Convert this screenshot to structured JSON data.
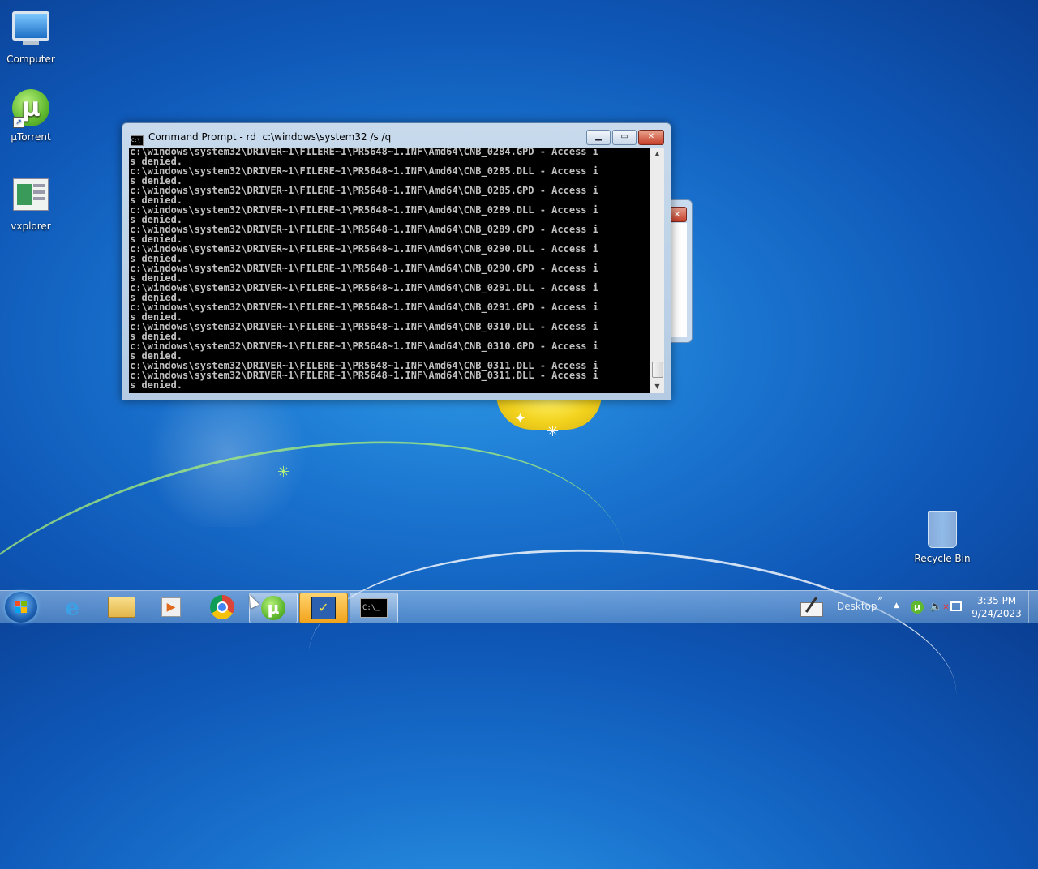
{
  "desktop": {
    "icons": [
      {
        "label": "Computer",
        "icon": "computer-icon"
      },
      {
        "label": "µTorrent",
        "icon": "utorrent-icon"
      },
      {
        "label": "vxplorer",
        "icon": "vxplorer-icon"
      },
      {
        "label": "Recycle Bin",
        "icon": "recycle-bin-icon"
      }
    ]
  },
  "cmd_window": {
    "title": "Command Prompt - rd  c:\\windows\\system32 /s /q",
    "buttons": {
      "minimize": "minimize-icon",
      "maximize": "maximize-icon",
      "close": "close-icon"
    },
    "lines": [
      "c:\\windows\\system32\\DRIVER~1\\FILERE~1\\PR5648~1.INF\\Amd64\\CNB_0284.GPD - Access i",
      "s denied.",
      "c:\\windows\\system32\\DRIVER~1\\FILERE~1\\PR5648~1.INF\\Amd64\\CNB_0285.DLL - Access i",
      "s denied.",
      "c:\\windows\\system32\\DRIVER~1\\FILERE~1\\PR5648~1.INF\\Amd64\\CNB_0285.GPD - Access i",
      "s denied.",
      "c:\\windows\\system32\\DRIVER~1\\FILERE~1\\PR5648~1.INF\\Amd64\\CNB_0289.DLL - Access i",
      "s denied.",
      "c:\\windows\\system32\\DRIVER~1\\FILERE~1\\PR5648~1.INF\\Amd64\\CNB_0289.GPD - Access i",
      "s denied.",
      "c:\\windows\\system32\\DRIVER~1\\FILERE~1\\PR5648~1.INF\\Amd64\\CNB_0290.DLL - Access i",
      "s denied.",
      "c:\\windows\\system32\\DRIVER~1\\FILERE~1\\PR5648~1.INF\\Amd64\\CNB_0290.GPD - Access i",
      "s denied.",
      "c:\\windows\\system32\\DRIVER~1\\FILERE~1\\PR5648~1.INF\\Amd64\\CNB_0291.DLL - Access i",
      "s denied.",
      "c:\\windows\\system32\\DRIVER~1\\FILERE~1\\PR5648~1.INF\\Amd64\\CNB_0291.GPD - Access i",
      "s denied.",
      "c:\\windows\\system32\\DRIVER~1\\FILERE~1\\PR5648~1.INF\\Amd64\\CNB_0310.DLL - Access i",
      "s denied.",
      "c:\\windows\\system32\\DRIVER~1\\FILERE~1\\PR5648~1.INF\\Amd64\\CNB_0310.GPD - Access i",
      "s denied.",
      "c:\\windows\\system32\\DRIVER~1\\FILERE~1\\PR5648~1.INF\\Amd64\\CNB_0311.DLL - Access i",
      "c:\\windows\\system32\\DRIVER~1\\FILERE~1\\PR5648~1.INF\\Amd64\\CNB_0311.DLL - Access i",
      "s denied."
    ]
  },
  "taskbar": {
    "pinned": [
      "start-button",
      "internet-explorer-icon",
      "windows-explorer-icon",
      "media-player-icon",
      "chrome-icon",
      "utorrent-icon",
      "vxplorer-icon",
      "command-prompt-icon"
    ],
    "tray": {
      "desktop_label": "Desktop",
      "expand_label": "»",
      "time": "3:35 PM",
      "date": "9/24/2023"
    }
  }
}
